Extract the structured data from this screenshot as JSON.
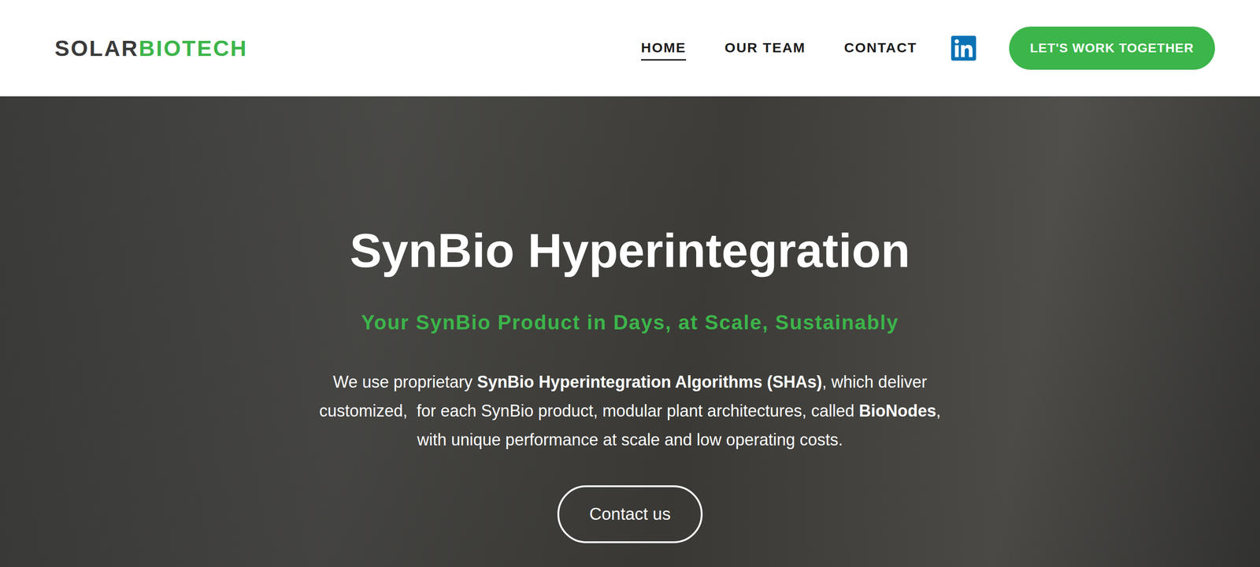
{
  "header": {
    "logo": {
      "dark": "SOLAR",
      "accent": "BIOTECH"
    },
    "nav": [
      {
        "label": "HOME",
        "selected": true
      },
      {
        "label": "OUR TEAM",
        "selected": false
      },
      {
        "label": "CONTACT",
        "selected": false
      }
    ],
    "cta": "LET'S WORK TOGETHER"
  },
  "hero": {
    "title": "SynBio Hyperintegration",
    "subtitle": "Your SynBio Product in Days, at Scale, Sustainably",
    "paragraph": [
      {
        "text": "We use proprietary ",
        "bold": false
      },
      {
        "text": "SynBio Hyperintegration Algorithms (SHAs)",
        "bold": true
      },
      {
        "text": ", which deliver customized,  for each SynBio product, modular plant architectures, called ",
        "bold": false
      },
      {
        "text": "BioNodes",
        "bold": true
      },
      {
        "text": ", with unique performance at scale and low operating costs.",
        "bold": false
      }
    ],
    "button": "Contact us"
  }
}
